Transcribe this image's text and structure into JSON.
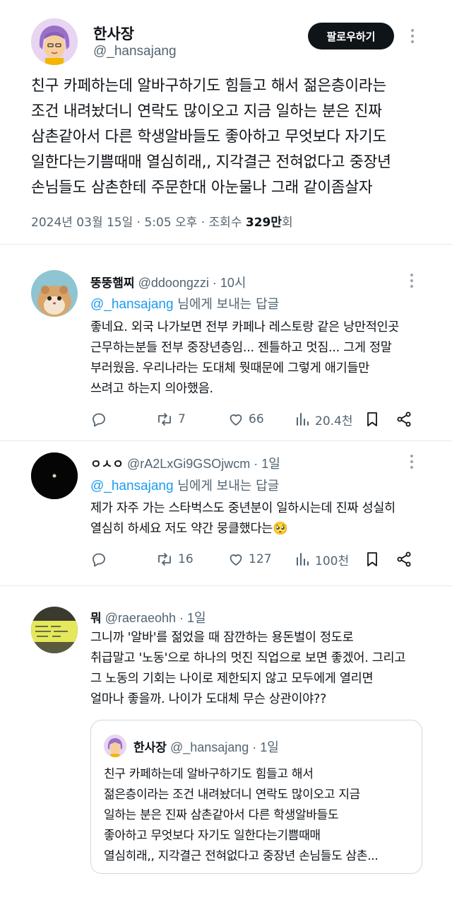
{
  "main_tweet": {
    "author_name": "한사장",
    "author_handle": "@_hansajang",
    "follow_label": "팔로우하기",
    "text": "친구 카페하는데 알바구하기도 힘들고 해서 젊은층이라는\n조건 내려놨더니 연락도 많이오고 지금 일하는 분은 진짜\n삼촌같아서 다른 학생알바들도 좋아하고 무엇보다 자기도\n일한다는기쁨때매 열심히래,, 지각결근 전혀없다고 중장년\n손님들도 삼촌한테 주문한대 아눈물나 그래 같이좀살자",
    "meta_prefix": "2024년 03월 15일 · 5:05 오후 · 조회수 ",
    "views": "329만",
    "views_suffix": "회"
  },
  "replies": [
    {
      "name": "뚱뚱햄찌",
      "handle_time": "@ddoongzzi · 10시",
      "reply_to_mention": "@_hansajang",
      "reply_to_suffix": " 님에게 보내는 답글",
      "text": "좋네요. 외국 나가보면 전부 카페나 레스토랑 같은 낭만적인곳\n근무하는분들 전부 중장년층임... 젠틀하고 멋짐... 그게 정말\n부러웠음. 우리나라는 도대체 뭣때문에 그렇게 애기들만\n쓰려고 하는지 의아했음.",
      "retweets": "7",
      "likes": "66",
      "views": "20.4천"
    },
    {
      "name": "ㅇㅅㅇ",
      "handle_time": "@rA2LxGi9GSOjwcm · 1일",
      "reply_to_mention": "@_hansajang",
      "reply_to_suffix": " 님에게 보내는 답글",
      "text": "제가 자주 가는 스타벅스도 중년분이 일하시는데 진짜 성실히\n열심히 하세요 저도 약간 뭉클했다는🥺",
      "retweets": "16",
      "likes": "127",
      "views": "100천"
    },
    {
      "name": "뭐",
      "handle_time": "@raeraeohh · 1일",
      "text": "그니까 '알바'를 젊었을 때 잠깐하는 용돈벌이 정도로\n취급말고 '노동'으로 하나의 멋진 직업으로 보면 좋겠어. 그리고\n그 노동의 기회는 나이로 제한되지 않고 모두에게 열리면\n얼마나 좋을까. 나이가 도대체 무슨 상관이야??"
    }
  ],
  "quote": {
    "name": "한사장",
    "handle_time": "@_hansajang · 1일",
    "text": "친구 카페하는데 알바구하기도 힘들고 해서\n젊은층이라는 조건 내려놨더니 연락도 많이오고 지금\n일하는 분은 진짜 삼촌같아서 다른 학생알바들도\n좋아하고 무엇보다 자기도 일한다는기쁨때매\n열심히래,, 지각결근 전혀없다고 중장년 손님들도 삼촌..."
  },
  "icons": {
    "reply": "speech-bubble-icon",
    "retweet": "retweet-icon",
    "like": "heart-icon",
    "views": "bar-chart-icon",
    "bookmark": "bookmark-icon",
    "share": "share-icon",
    "more": "more-vertical-icon"
  },
  "colors": {
    "accent": "#1d9bf0",
    "text": "#0f1419",
    "secondary": "#536471",
    "follow_bg": "#0f1419"
  }
}
